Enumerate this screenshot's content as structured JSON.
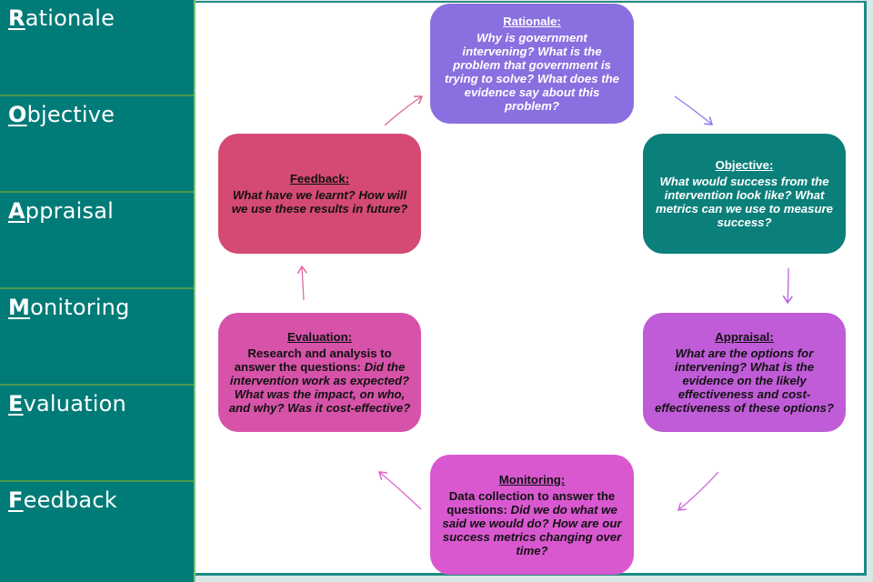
{
  "sidebar": {
    "items": [
      {
        "initial": "R",
        "rest": "ationale"
      },
      {
        "initial": "O",
        "rest": "bjective"
      },
      {
        "initial": "A",
        "rest": "ppraisal"
      },
      {
        "initial": "M",
        "rest": "onitoring"
      },
      {
        "initial": "E",
        "rest": "valuation"
      },
      {
        "initial": "F",
        "rest": "eedback"
      }
    ]
  },
  "colors": {
    "sidebar_bg": "#007b78",
    "rationale": "#8a6fe0",
    "objective": "#0b7f7a",
    "appraisal": "#c05cd8",
    "monitoring": "#d958d0",
    "evaluation": "#d653a9",
    "feedback": "#d44a72"
  },
  "cycle": {
    "rationale": {
      "title": "Rationale:",
      "body": "Why is government intervening? What is the problem that government is trying to solve? What does the evidence say about this problem?"
    },
    "objective": {
      "title": "Objective:",
      "body": "What would success from the intervention look like? What metrics can we use to measure success?"
    },
    "appraisal": {
      "title": "Appraisal:",
      "body": "What are the options for intervening? What is the evidence on the likely effectiveness and cost-effectiveness of these options?"
    },
    "monitoring": {
      "title": "Monitoring:",
      "body_plain": "Data collection to answer the questions: ",
      "body_italic": "Did we do what we said we would do? How are our success metrics changing over time?"
    },
    "evaluation": {
      "title": "Evaluation:",
      "body_plain": "Research and analysis to answer the questions: ",
      "body_italic": "Did the intervention work as expected? What was the impact, on who, and why? Was it cost-effective?"
    },
    "feedback": {
      "title": "Feedback:",
      "body": "What have we learnt? How will we use these results in future?"
    }
  }
}
